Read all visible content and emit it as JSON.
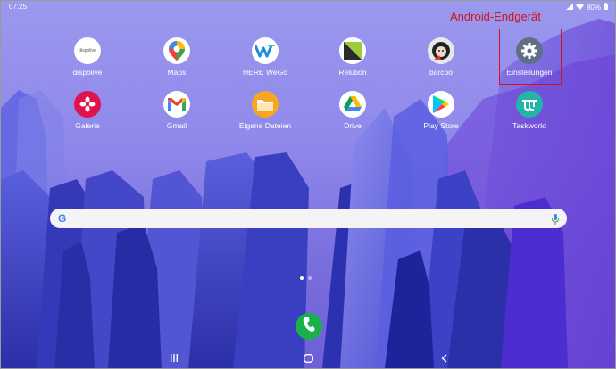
{
  "status_bar": {
    "time": "07:25",
    "battery": "80%"
  },
  "annotation": "Android-Endgerät",
  "apps_row1": [
    {
      "label": "dispolive",
      "icon": "dispolive-icon",
      "icon_text": "dispolive"
    },
    {
      "label": "Maps",
      "icon": "maps-icon"
    },
    {
      "label": "HERE WeGo",
      "icon": "here-wego-icon"
    },
    {
      "label": "Relution",
      "icon": "relution-icon"
    },
    {
      "label": "barcoo",
      "icon": "barcoo-icon"
    },
    {
      "label": "Einstellungen",
      "icon": "gear-icon"
    }
  ],
  "apps_row2": [
    {
      "label": "Galerie",
      "icon": "gallery-icon"
    },
    {
      "label": "Gmail",
      "icon": "gmail-icon"
    },
    {
      "label": "Eigene Dateien",
      "icon": "folder-icon"
    },
    {
      "label": "Drive",
      "icon": "drive-icon"
    },
    {
      "label": "Play Store",
      "icon": "play-store-icon"
    },
    {
      "label": "Taskworld",
      "icon": "taskworld-icon"
    }
  ],
  "search": {
    "logo": "G"
  },
  "colors": {
    "annotation": "#d1131b",
    "phone": "#17b04b",
    "gallery": "#e0134f",
    "folder": "#f5a623",
    "taskworld": "#24b3a6"
  }
}
